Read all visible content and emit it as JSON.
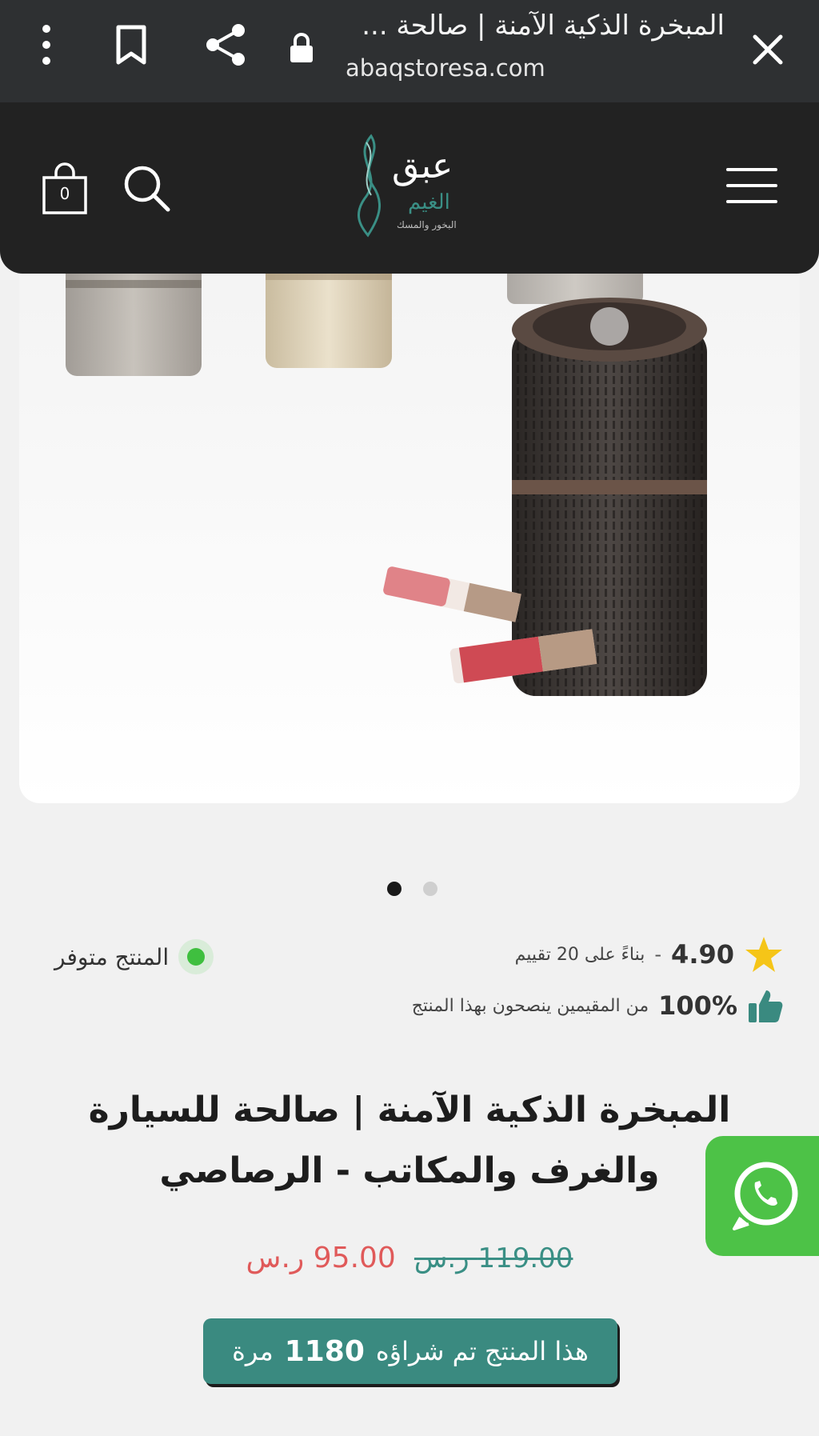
{
  "browser": {
    "title": "المبخرة الذكية الآمنة | صالحة ...",
    "url": "abaqstoresa.com"
  },
  "header": {
    "logo_text": "عبق",
    "logo_sub": "الغيم",
    "logo_tagline": "البخور والمسك",
    "cart_count": "0"
  },
  "carousel": {
    "slides": 2,
    "active": 1
  },
  "rating": {
    "value": "4.90",
    "separator": "-",
    "count_text": "بناءً على 20 تقييم"
  },
  "recommend": {
    "percent": "100%",
    "text": "من المقيمين ينصحون بهذا المنتج"
  },
  "stock": {
    "text": "المنتج متوفر"
  },
  "product": {
    "title": "المبخرة الذكية الآمنة | صالحة للسيارة والغرف والمكاتب - الرصاصي",
    "price_new": "95.00 ر.س",
    "price_old": "119.00 ر.س",
    "bought_prefix": "هذا المنتج تم شراؤه",
    "bought_count": "1180",
    "bought_suffix": "مرة"
  },
  "colors": {
    "accent": "#3a8a80",
    "sale": "#e05a5a",
    "whatsapp": "#4dc247",
    "header_bg": "#222222",
    "star": "#f5c518"
  }
}
